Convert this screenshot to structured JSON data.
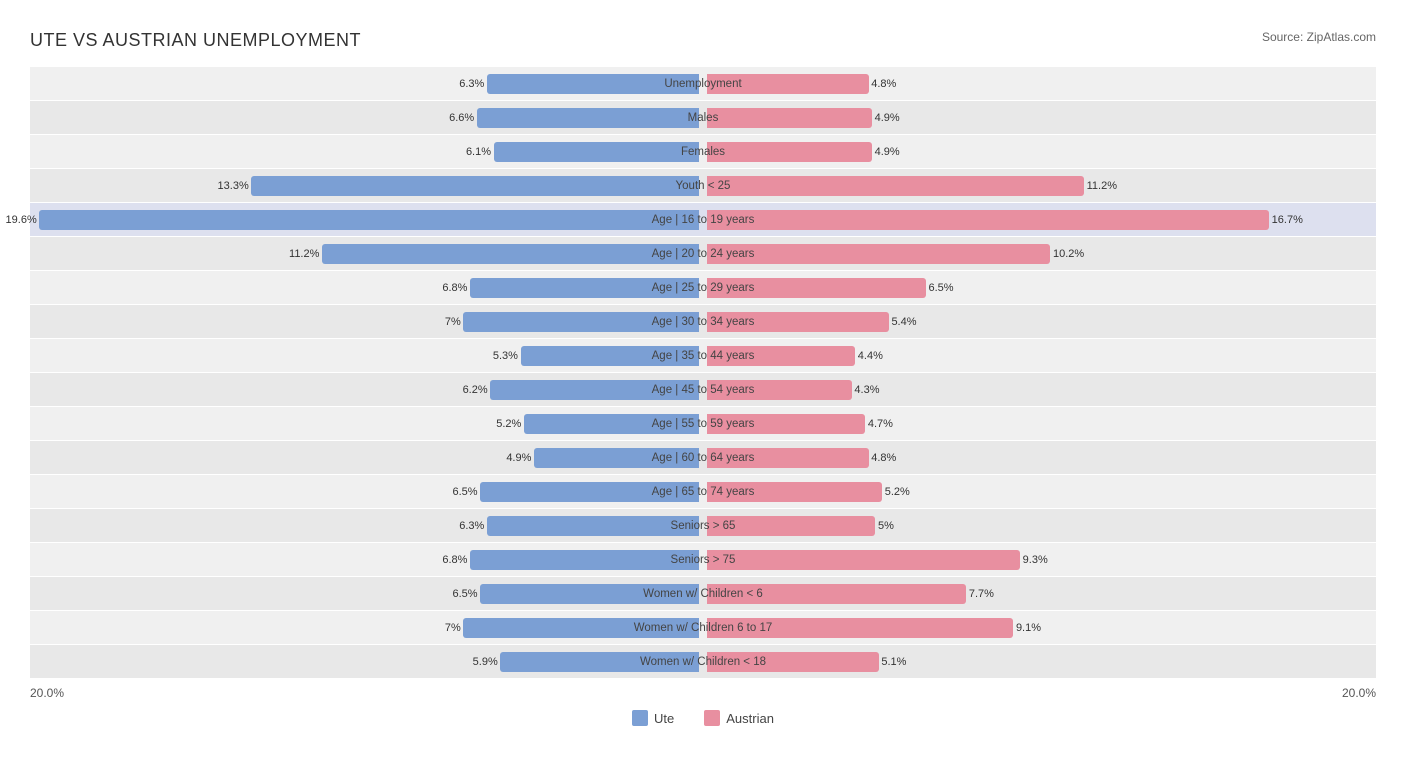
{
  "title": "UTE VS AUSTRIAN UNEMPLOYMENT",
  "source": "Source: ZipAtlas.com",
  "maxValue": 20.0,
  "axisLeft": "20.0%",
  "axisRight": "20.0%",
  "legend": {
    "ute_label": "Ute",
    "austrian_label": "Austrian",
    "ute_color": "#7b9fd4",
    "austrian_color": "#e88fa0"
  },
  "rows": [
    {
      "label": "Unemployment",
      "ute": 6.3,
      "austrian": 4.8,
      "highlight": false
    },
    {
      "label": "Males",
      "ute": 6.6,
      "austrian": 4.9,
      "highlight": false
    },
    {
      "label": "Females",
      "ute": 6.1,
      "austrian": 4.9,
      "highlight": false
    },
    {
      "label": "Youth < 25",
      "ute": 13.3,
      "austrian": 11.2,
      "highlight": false
    },
    {
      "label": "Age | 16 to 19 years",
      "ute": 19.6,
      "austrian": 16.7,
      "highlight": true
    },
    {
      "label": "Age | 20 to 24 years",
      "ute": 11.2,
      "austrian": 10.2,
      "highlight": false
    },
    {
      "label": "Age | 25 to 29 years",
      "ute": 6.8,
      "austrian": 6.5,
      "highlight": false
    },
    {
      "label": "Age | 30 to 34 years",
      "ute": 7.0,
      "austrian": 5.4,
      "highlight": false
    },
    {
      "label": "Age | 35 to 44 years",
      "ute": 5.3,
      "austrian": 4.4,
      "highlight": false
    },
    {
      "label": "Age | 45 to 54 years",
      "ute": 6.2,
      "austrian": 4.3,
      "highlight": false
    },
    {
      "label": "Age | 55 to 59 years",
      "ute": 5.2,
      "austrian": 4.7,
      "highlight": false
    },
    {
      "label": "Age | 60 to 64 years",
      "ute": 4.9,
      "austrian": 4.8,
      "highlight": false
    },
    {
      "label": "Age | 65 to 74 years",
      "ute": 6.5,
      "austrian": 5.2,
      "highlight": false
    },
    {
      "label": "Seniors > 65",
      "ute": 6.3,
      "austrian": 5.0,
      "highlight": false
    },
    {
      "label": "Seniors > 75",
      "ute": 6.8,
      "austrian": 9.3,
      "highlight": false
    },
    {
      "label": "Women w/ Children < 6",
      "ute": 6.5,
      "austrian": 7.7,
      "highlight": false
    },
    {
      "label": "Women w/ Children 6 to 17",
      "ute": 7.0,
      "austrian": 9.1,
      "highlight": false
    },
    {
      "label": "Women w/ Children < 18",
      "ute": 5.9,
      "austrian": 5.1,
      "highlight": false
    }
  ]
}
